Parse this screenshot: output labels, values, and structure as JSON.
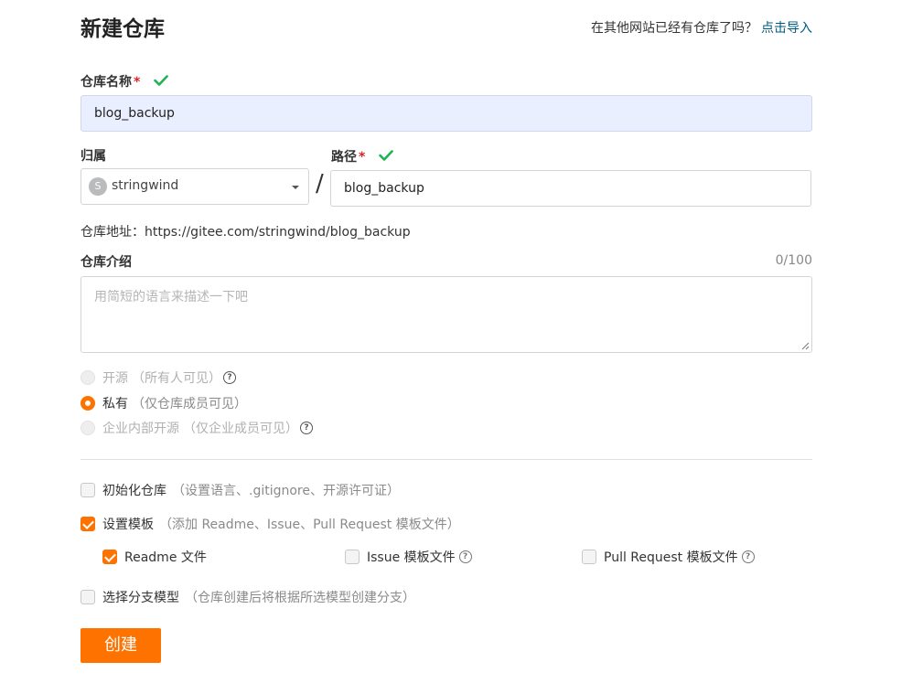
{
  "header": {
    "title": "新建仓库",
    "import_prompt": "在其他网站已经有仓库了吗？",
    "import_link": "点击导入"
  },
  "repo_name": {
    "label": "仓库名称",
    "required_mark": "*",
    "value": "blog_backup"
  },
  "owner": {
    "label": "归属",
    "avatar_letter": "S",
    "value": "stringwind"
  },
  "path": {
    "label": "路径",
    "required_mark": "*",
    "separator": "/",
    "value": "blog_backup"
  },
  "address": {
    "label": "仓库地址：",
    "url": "https://gitee.com/stringwind/blog_backup"
  },
  "description": {
    "label": "仓库介绍",
    "counter": "0/100",
    "placeholder": "用简短的语言来描述一下吧"
  },
  "visibility": [
    {
      "label": "开源",
      "note": "（所有人可见）",
      "selected": false,
      "disabled": true,
      "help": "?"
    },
    {
      "label": "私有",
      "note": "（仅仓库成员可见）",
      "selected": true,
      "disabled": false
    },
    {
      "label": "企业内部开源",
      "note": "（仅企业成员可见）",
      "selected": false,
      "disabled": true,
      "help": "?"
    }
  ],
  "options": {
    "init_repo": {
      "label": "初始化仓库",
      "note": "（设置语言、.gitignore、开源许可证）",
      "checked": false
    },
    "set_template": {
      "label": "设置模板",
      "note": "（添加 Readme、Issue、Pull Request 模板文件）",
      "checked": true
    },
    "templates": [
      {
        "label": "Readme 文件",
        "checked": true
      },
      {
        "label": "Issue 模板文件",
        "checked": false,
        "help": "?"
      },
      {
        "label": "Pull Request 模板文件",
        "checked": false,
        "help": "?"
      }
    ],
    "branch_model": {
      "label": "选择分支模型",
      "note": "（仓库创建后将根据所选模型创建分支）",
      "checked": false
    }
  },
  "submit": {
    "label": "创建"
  },
  "colors": {
    "accent": "#fe7300",
    "link": "#005980",
    "check_green": "#21b351"
  }
}
